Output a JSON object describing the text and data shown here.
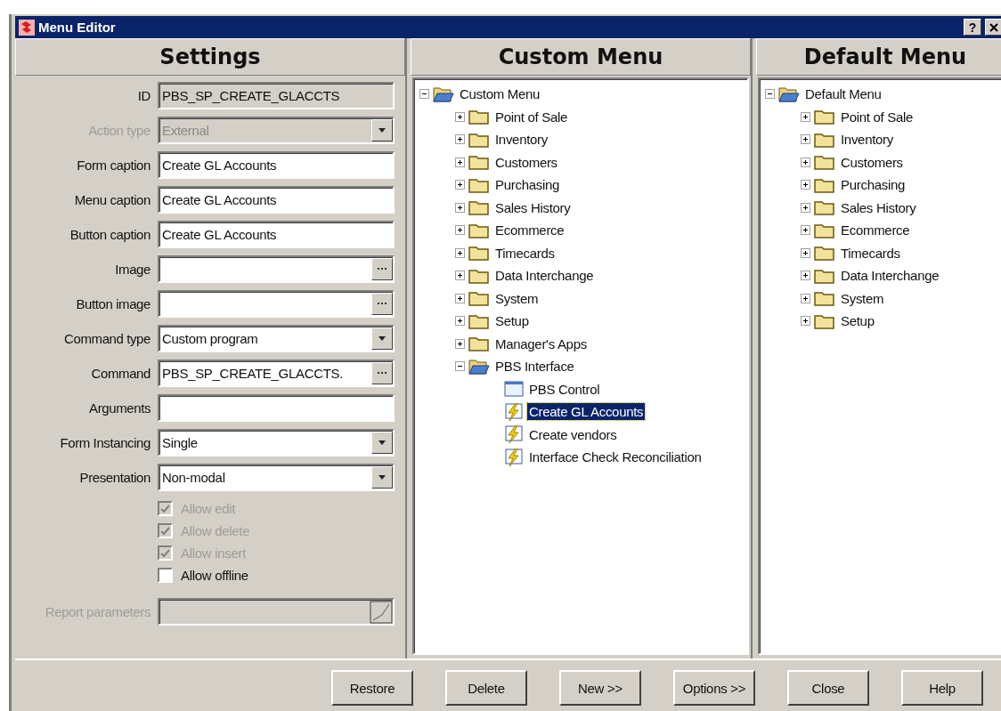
{
  "window": {
    "title": "Menu Editor",
    "controls": [
      "?"
    ]
  },
  "settings": {
    "header": "Settings",
    "fields": [
      {
        "label": "ID",
        "kind": "readonly",
        "value": "PBS_SP_CREATE_GLACCTS",
        "disabled": false
      },
      {
        "label": "Action type",
        "kind": "combo",
        "value": "External",
        "disabled": true
      },
      {
        "label": "Form caption",
        "kind": "text",
        "value": "Create GL Accounts",
        "disabled": false
      },
      {
        "label": "Menu caption",
        "kind": "text",
        "value": "Create GL Accounts",
        "disabled": false
      },
      {
        "label": "Button caption",
        "kind": "text",
        "value": "Create GL Accounts",
        "disabled": false
      },
      {
        "label": "Image",
        "kind": "browse",
        "disabled": false
      },
      {
        "label": "Button image",
        "kind": "browse",
        "disabled": false
      },
      {
        "label": "Command type",
        "kind": "combo",
        "value": "Custom program",
        "disabled": false
      },
      {
        "label": "Command",
        "kind": "browse",
        "value": "PBS_SP_CREATE_GLACCTS.",
        "disabled": false
      },
      {
        "label": "Arguments",
        "kind": "text",
        "disabled": false
      },
      {
        "label": "Form Instancing",
        "kind": "combo",
        "value": "Single",
        "disabled": false
      },
      {
        "label": "Presentation",
        "kind": "combo",
        "value": "Non-modal",
        "disabled": false
      }
    ],
    "checkboxes": [
      {
        "label": "Allow edit",
        "checked": true,
        "disabled": true
      },
      {
        "label": "Allow delete",
        "checked": true,
        "disabled": true
      },
      {
        "label": "Allow insert",
        "checked": true,
        "disabled": true
      },
      {
        "label": "Allow offline",
        "checked": false,
        "disabled": false
      }
    ],
    "report": {
      "label": "Report parameters",
      "disabled": true
    }
  },
  "custom_menu": {
    "header": "Custom Menu",
    "tree": [
      {
        "label": "Custom Menu",
        "kind": "folder",
        "expanded": true,
        "selected": false,
        "children": [
          {
            "label": "Point of Sale",
            "kind": "folder",
            "expanded": false,
            "selected": false
          },
          {
            "label": "Inventory",
            "kind": "folder",
            "expanded": false,
            "selected": false
          },
          {
            "label": "Customers",
            "kind": "folder",
            "expanded": false,
            "selected": false
          },
          {
            "label": "Purchasing",
            "kind": "folder",
            "expanded": false,
            "selected": false
          },
          {
            "label": "Sales History",
            "kind": "folder",
            "expanded": false,
            "selected": false
          },
          {
            "label": "Ecommerce",
            "kind": "folder",
            "expanded": false,
            "selected": false
          },
          {
            "label": "Timecards",
            "kind": "folder",
            "expanded": false,
            "selected": false
          },
          {
            "label": "Data Interchange",
            "kind": "folder",
            "expanded": false,
            "selected": false
          },
          {
            "label": "System",
            "kind": "folder",
            "expanded": false,
            "selected": false
          },
          {
            "label": "Setup",
            "kind": "folder",
            "expanded": false,
            "selected": false
          },
          {
            "label": "Manager's Apps",
            "kind": "folder",
            "expanded": false,
            "selected": false
          },
          {
            "label": "PBS Interface",
            "kind": "folder",
            "expanded": true,
            "selected": false,
            "children": [
              {
                "label": "PBS Control",
                "kind": "form",
                "selected": false
              },
              {
                "label": "Create GL Accounts",
                "kind": "action",
                "selected": true
              },
              {
                "label": "Create vendors",
                "kind": "action",
                "selected": false
              },
              {
                "label": "Interface Check Reconciliation",
                "kind": "action",
                "selected": false
              }
            ]
          }
        ]
      }
    ]
  },
  "default_menu": {
    "header": "Default Menu",
    "tree": [
      {
        "label": "Default Menu",
        "kind": "folder",
        "expanded": true,
        "selected": false,
        "children": [
          {
            "label": "Point of Sale",
            "kind": "folder",
            "expanded": false,
            "selected": false
          },
          {
            "label": "Inventory",
            "kind": "folder",
            "expanded": false,
            "selected": false
          },
          {
            "label": "Customers",
            "kind": "folder",
            "expanded": false,
            "selected": false
          },
          {
            "label": "Purchasing",
            "kind": "folder",
            "expanded": false,
            "selected": false
          },
          {
            "label": "Sales History",
            "kind": "folder",
            "expanded": false,
            "selected": false
          },
          {
            "label": "Ecommerce",
            "kind": "folder",
            "expanded": false,
            "selected": false
          },
          {
            "label": "Timecards",
            "kind": "folder",
            "expanded": false,
            "selected": false
          },
          {
            "label": "Data Interchange",
            "kind": "folder",
            "expanded": false,
            "selected": false
          },
          {
            "label": "System",
            "kind": "folder",
            "expanded": false,
            "selected": false
          },
          {
            "label": "Setup",
            "kind": "folder",
            "expanded": false,
            "selected": false
          }
        ]
      }
    ]
  },
  "buttons": [
    "Restore",
    "Delete",
    "New >>",
    "Options >>",
    "Close",
    "Help"
  ]
}
